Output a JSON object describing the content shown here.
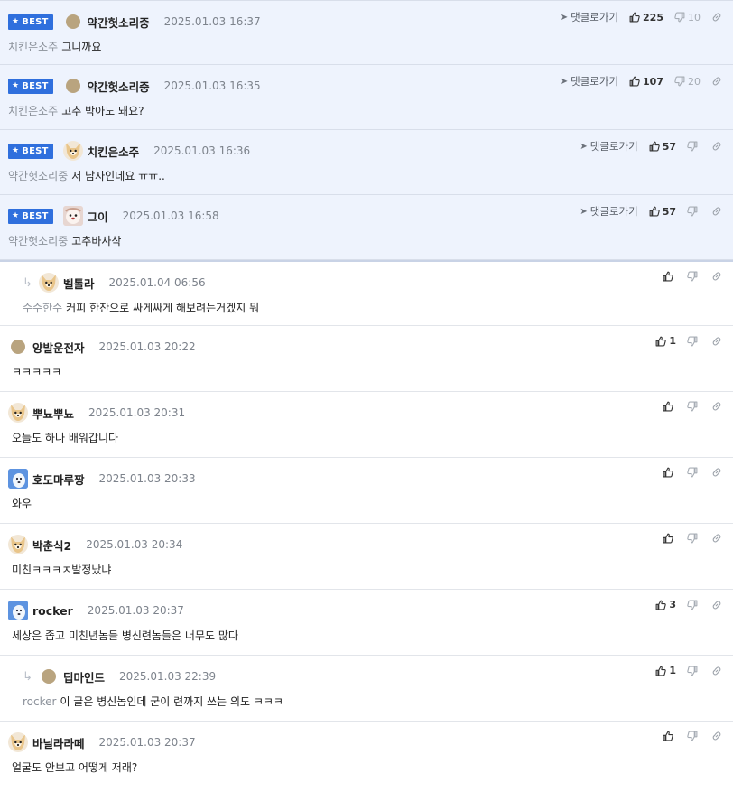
{
  "ui": {
    "best_label": "BEST",
    "goto_label": "댓글로가기",
    "reply_icon": "reply-arrow-icon",
    "colors": {
      "best_bg": "#eef3fd",
      "badge": "#2f6fdd",
      "divider": "#e2e5ea"
    }
  },
  "comments": [
    {
      "best": true,
      "avatar": "dot",
      "nick": "약간헛소리중",
      "date": "2025.01.03 16:37",
      "mention": "치킨은소주",
      "text": "그니까요",
      "up": "225",
      "down": "10"
    },
    {
      "best": true,
      "avatar": "dot",
      "nick": "약간헛소리중",
      "date": "2025.01.03 16:35",
      "mention": "치킨은소주",
      "text": "고추 박아도 돼요?",
      "up": "107",
      "down": "20"
    },
    {
      "best": true,
      "avatar": "dog",
      "nick": "치킨은소주",
      "date": "2025.01.03 16:36",
      "mention": "약간헛소리중",
      "text": "저 남자인데요 ㅠㅠ..",
      "up": "57",
      "down": ""
    },
    {
      "best": true,
      "avatar": "red",
      "nick": "그이",
      "date": "2025.01.03 16:58",
      "mention": "약간헛소리중",
      "text": "고추바사삭",
      "up": "57",
      "down": ""
    },
    {
      "best": false,
      "reply": true,
      "avatar": "dog",
      "nick": "벨톨라",
      "date": "2025.01.04 06:56",
      "mention": "수수한수",
      "text": "커피 한잔으로 싸게싸게 해보려는거겠지 뭐",
      "up": "",
      "down": ""
    },
    {
      "best": false,
      "avatar": "dot",
      "nick": "양발운전자",
      "date": "2025.01.03 20:22",
      "mention": "",
      "text": "ㅋㅋㅋㅋㅋ",
      "up": "1",
      "down": ""
    },
    {
      "best": false,
      "avatar": "dog",
      "nick": "뿌뇨뿌뇨",
      "date": "2025.01.03 20:31",
      "mention": "",
      "text": "오늘도 하나 배워갑니다",
      "up": "",
      "down": ""
    },
    {
      "best": false,
      "avatar": "blue",
      "nick": "호도마루짱",
      "date": "2025.01.03 20:33",
      "mention": "",
      "text": "와우",
      "up": "",
      "down": ""
    },
    {
      "best": false,
      "avatar": "dog",
      "nick": "박춘식2",
      "date": "2025.01.03 20:34",
      "mention": "",
      "text": "미친ㅋㅋㅋㅈ발정났냐",
      "up": "",
      "down": ""
    },
    {
      "best": false,
      "avatar": "blue",
      "nick": "rocker",
      "date": "2025.01.03 20:37",
      "mention": "",
      "text": "세상은 좁고 미친년놈들 병신련놈들은 너무도 많다",
      "up": "3",
      "down": ""
    },
    {
      "best": false,
      "reply": true,
      "avatar": "dot",
      "nick": "딥마인드",
      "date": "2025.01.03 22:39",
      "mention": "rocker",
      "text": "이 글은 병신놈인데 굳이 련까지 쓰는 의도 ㅋㅋㅋ",
      "up": "1",
      "down": ""
    },
    {
      "best": false,
      "avatar": "dog",
      "nick": "바닐라라떼",
      "date": "2025.01.03 20:37",
      "mention": "",
      "text": "얼굴도 안보고 어떻게 저래?",
      "up": "",
      "down": ""
    }
  ]
}
